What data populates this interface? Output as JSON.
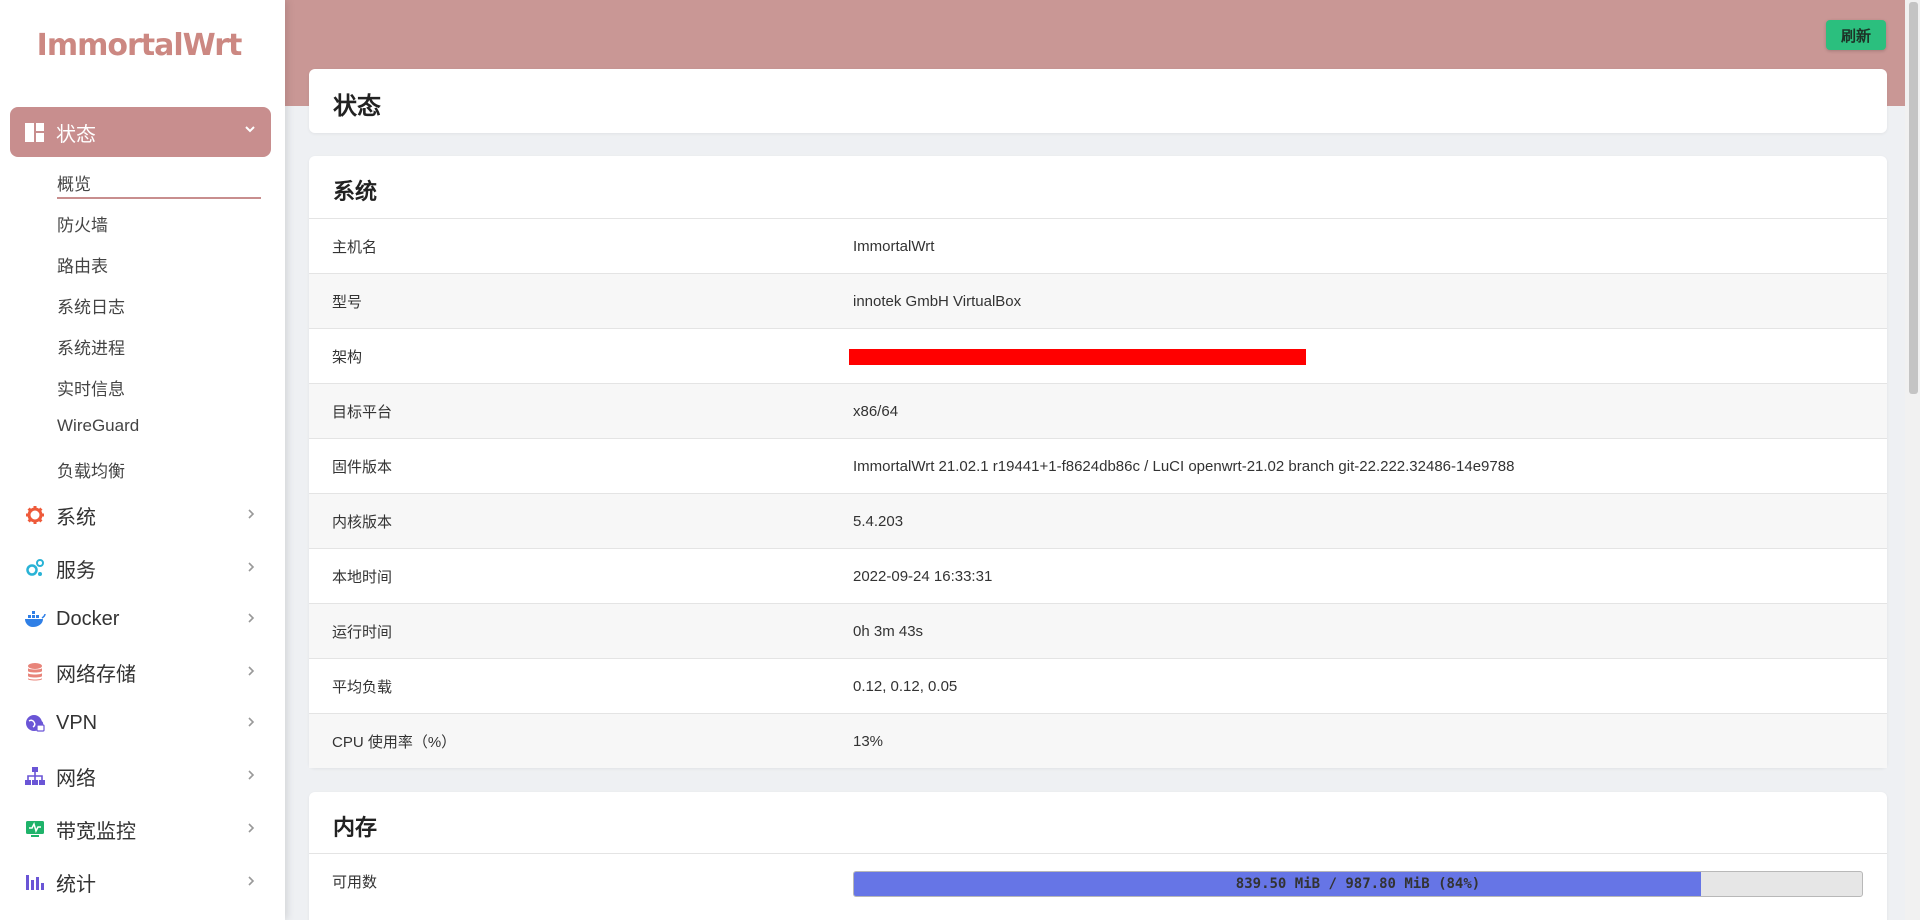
{
  "app": {
    "logo_text": "ImmortalWrt"
  },
  "colors": {
    "accent": "#c88e8e",
    "header": "#c99795",
    "refresh": "#2bbf7e",
    "progress_fill": "#6675e6",
    "redaction": "#ff0000"
  },
  "sidebar": {
    "active": {
      "label": "状态",
      "icon": "dashboard-icon"
    },
    "sub_items": [
      {
        "label": "概览"
      },
      {
        "label": "防火墙"
      },
      {
        "label": "路由表"
      },
      {
        "label": "系统日志"
      },
      {
        "label": "系统进程"
      },
      {
        "label": "实时信息"
      },
      {
        "label": "WireGuard"
      },
      {
        "label": "负载均衡"
      }
    ],
    "items": [
      {
        "label": "系统",
        "icon": "gear-icon"
      },
      {
        "label": "服务",
        "icon": "cogs-icon"
      },
      {
        "label": "Docker",
        "icon": "docker-icon"
      },
      {
        "label": "网络存储",
        "icon": "database-icon"
      },
      {
        "label": "VPN",
        "icon": "globe-lock-icon"
      },
      {
        "label": "网络",
        "icon": "sitemap-icon"
      },
      {
        "label": "带宽监控",
        "icon": "monitor-icon"
      },
      {
        "label": "统计",
        "icon": "bar-chart-icon"
      }
    ]
  },
  "header": {
    "refresh_label": "刷新"
  },
  "page": {
    "title": "状态"
  },
  "system": {
    "title": "系统",
    "rows": [
      {
        "label": "主机名",
        "value": "ImmortalWrt"
      },
      {
        "label": "型号",
        "value": "innotek GmbH VirtualBox"
      },
      {
        "label": "架构",
        "value": ""
      },
      {
        "label": "目标平台",
        "value": "x86/64"
      },
      {
        "label": "固件版本",
        "value": "ImmortalWrt 21.02.1 r19441+1-f8624db86c / LuCI openwrt-21.02 branch git-22.222.32486-14e9788"
      },
      {
        "label": "内核版本",
        "value": "5.4.203"
      },
      {
        "label": "本地时间",
        "value": "2022-09-24 16:33:31"
      },
      {
        "label": "运行时间",
        "value": "0h 3m 43s"
      },
      {
        "label": "平均负载",
        "value": "0.12, 0.12, 0.05"
      },
      {
        "label": "CPU 使用率（%）",
        "value": "13%"
      }
    ]
  },
  "memory": {
    "title": "内存",
    "rows": [
      {
        "label": "可用数",
        "text": "839.50 MiB / 987.80 MiB (84%)",
        "percent": 84
      }
    ]
  }
}
